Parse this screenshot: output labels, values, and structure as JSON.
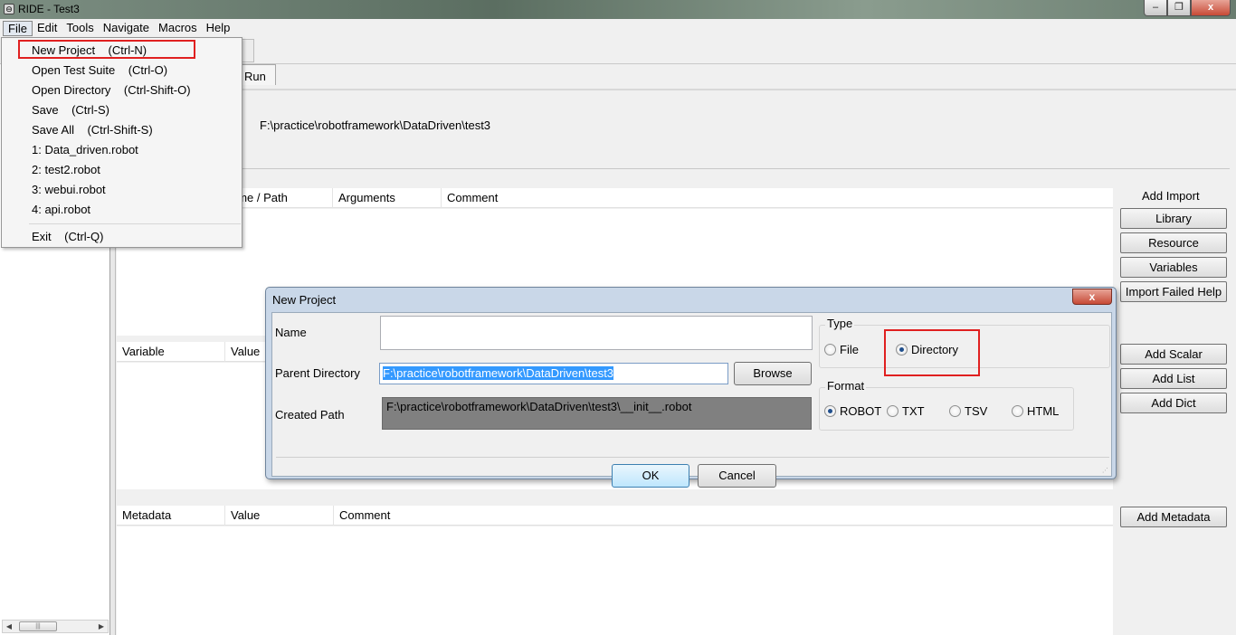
{
  "window": {
    "title": "RIDE - Test3",
    "controls": {
      "minimize": "–",
      "restore": "❐",
      "close": "x"
    }
  },
  "menubar": {
    "items": [
      "File",
      "Edit",
      "Tools",
      "Navigate",
      "Macros",
      "Help"
    ]
  },
  "file_menu": {
    "items": [
      {
        "label": "New Project",
        "shortcut": "(Ctrl-N)"
      },
      {
        "label": "Open Test Suite",
        "shortcut": "(Ctrl-O)"
      },
      {
        "label": "Open Directory",
        "shortcut": "(Ctrl-Shift-O)"
      },
      {
        "label": "Save",
        "shortcut": "(Ctrl-S)"
      },
      {
        "label": "Save All",
        "shortcut": "(Ctrl-Shift-S)"
      },
      {
        "label": "1: Data_driven.robot",
        "shortcut": ""
      },
      {
        "label": "2: test2.robot",
        "shortcut": ""
      },
      {
        "label": "3: webui.robot",
        "shortcut": ""
      },
      {
        "label": "4: api.robot",
        "shortcut": ""
      },
      {
        "label": "Exit",
        "shortcut": "(Ctrl-Q)"
      }
    ]
  },
  "editor": {
    "tab_run": "Run",
    "source_path": "F:\\practice\\robotframework\\DataDriven\\test3",
    "import_grid": {
      "columns": [
        "ame / Path",
        "Arguments",
        "Comment"
      ]
    },
    "variable_grid": {
      "columns": [
        "Variable",
        "Value"
      ]
    },
    "metadata_grid": {
      "columns": [
        "Metadata",
        "Value",
        "Comment"
      ]
    },
    "add_import_label": "Add Import",
    "import_buttons": [
      "Library",
      "Resource",
      "Variables",
      "Import Failed Help"
    ],
    "variable_buttons": [
      "Add Scalar",
      "Add List",
      "Add Dict"
    ],
    "metadata_button": "Add Metadata"
  },
  "dialog": {
    "title": "New Project",
    "close": "x",
    "name_label": "Name",
    "name_value": "",
    "parent_label": "Parent Directory",
    "parent_value": "F:\\practice\\robotframework\\DataDriven\\test3",
    "browse_label": "Browse",
    "created_label": "Created Path",
    "created_value": "F:\\practice\\robotframework\\DataDriven\\test3\\__init__.robot",
    "type_title": "Type",
    "type_options": [
      "File",
      "Directory"
    ],
    "type_selected": "Directory",
    "format_title": "Format",
    "format_options": [
      "ROBOT",
      "TXT",
      "TSV",
      "HTML"
    ],
    "format_selected": "ROBOT",
    "ok_label": "OK",
    "cancel_label": "Cancel"
  },
  "tree_scroll": {
    "thumb_glyph": "|||"
  },
  "colors": {
    "highlight_red": "#e02020",
    "selection_blue": "#3399ff"
  }
}
